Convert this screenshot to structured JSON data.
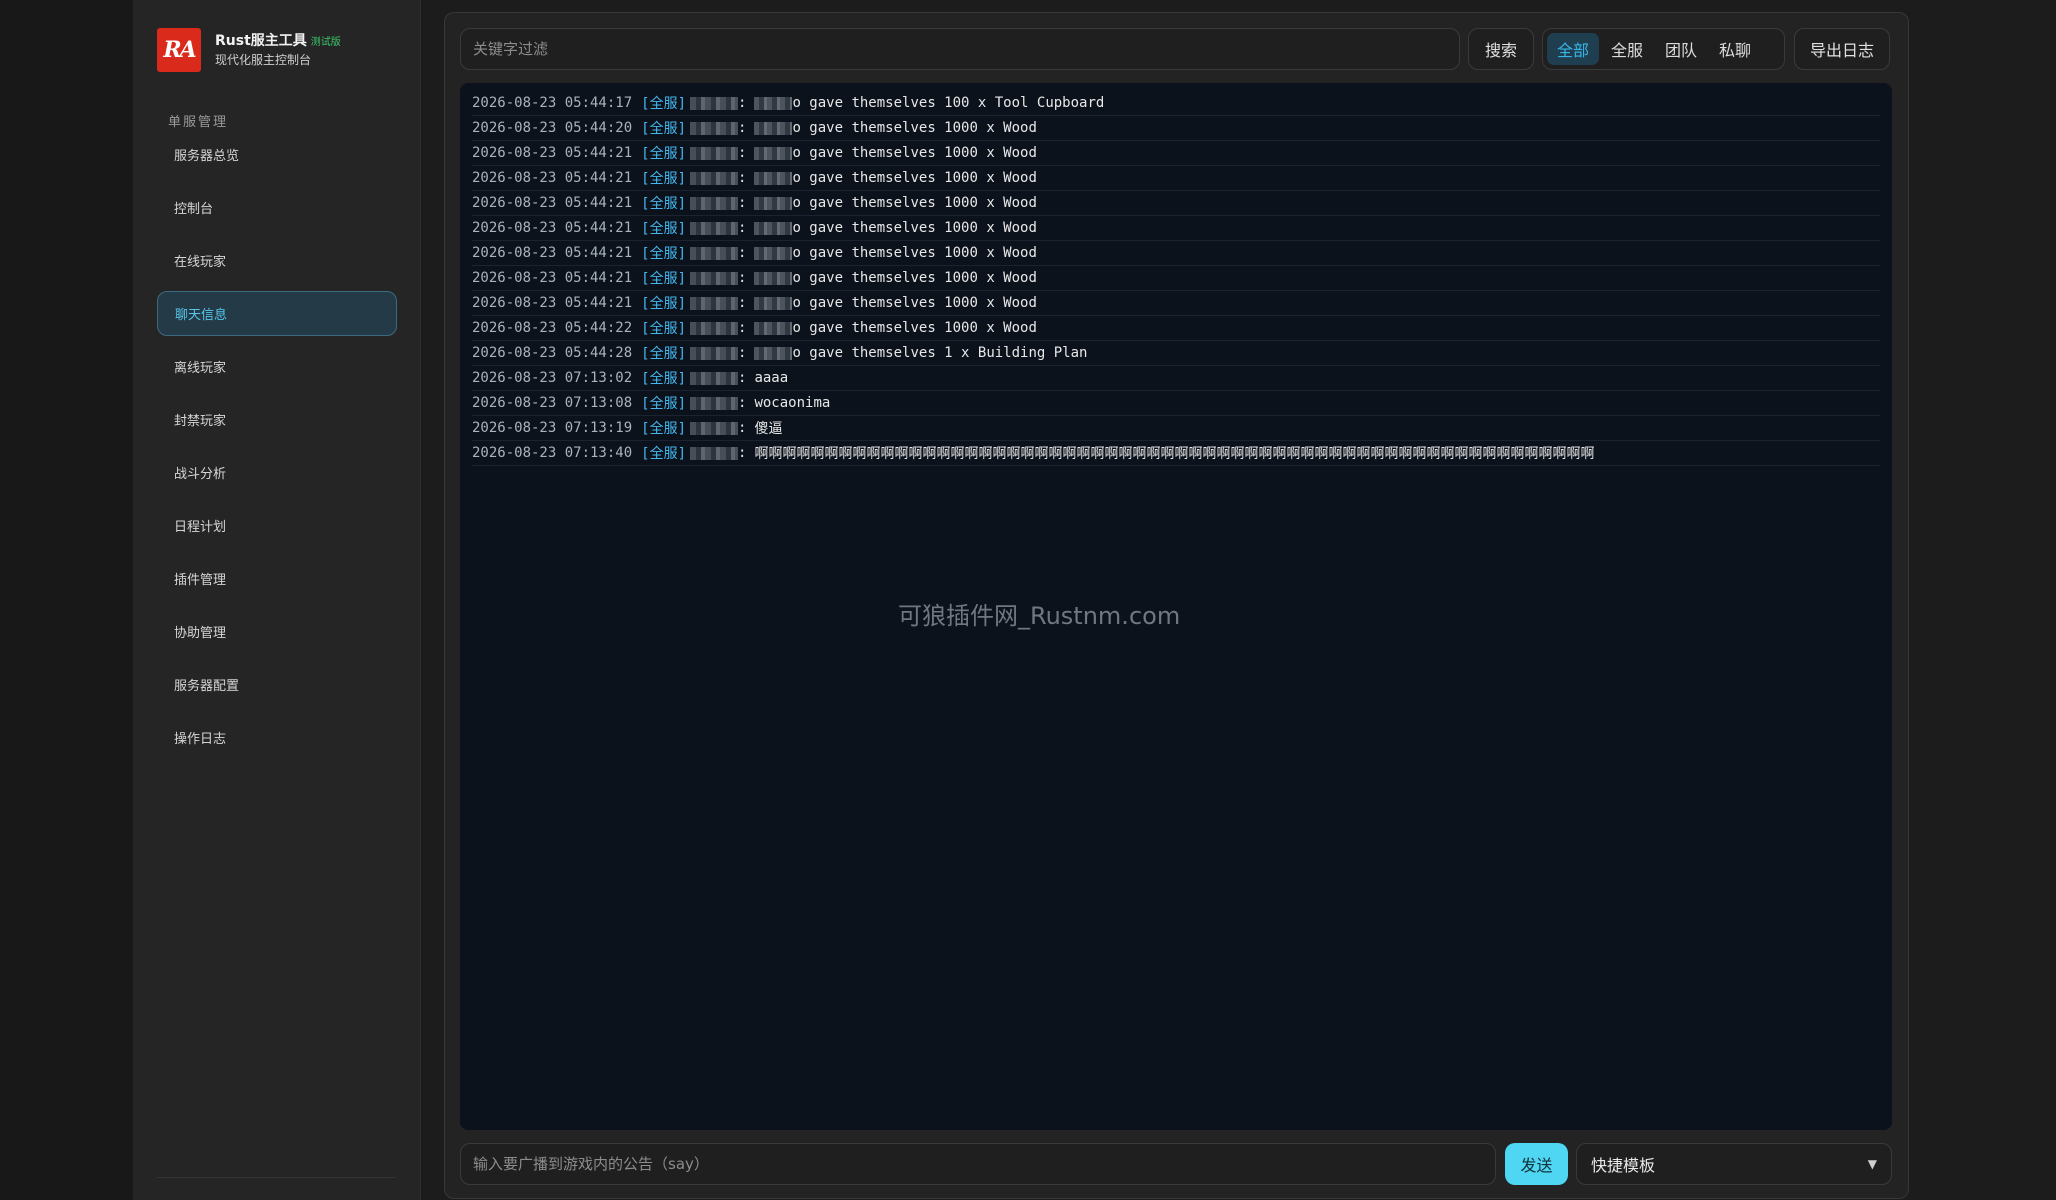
{
  "app": {
    "logo_text": "RA",
    "title": "Rust服主工具",
    "badge": "测试版",
    "subtitle": "现代化服主控制台"
  },
  "sidebar": {
    "section_label": "单服管理",
    "items": [
      {
        "label": "服务器总览",
        "active": false
      },
      {
        "label": "控制台",
        "active": false
      },
      {
        "label": "在线玩家",
        "active": false
      },
      {
        "label": "聊天信息",
        "active": true
      },
      {
        "label": "离线玩家",
        "active": false
      },
      {
        "label": "封禁玩家",
        "active": false
      },
      {
        "label": "战斗分析",
        "active": false
      },
      {
        "label": "日程计划",
        "active": false
      },
      {
        "label": "插件管理",
        "active": false
      },
      {
        "label": "协助管理",
        "active": false
      },
      {
        "label": "服务器配置",
        "active": false
      },
      {
        "label": "操作日志",
        "active": false
      }
    ]
  },
  "toolbar": {
    "filter_placeholder": "关键字过滤",
    "search_label": "搜索",
    "tabs": [
      {
        "label": "全部",
        "active": true
      },
      {
        "label": "全服",
        "active": false
      },
      {
        "label": "团队",
        "active": false
      },
      {
        "label": "私聊",
        "active": false
      }
    ],
    "export_label": "导出日志"
  },
  "log": {
    "rows": [
      {
        "ts": "2026-08-23 05:44:17",
        "channel": "[全服]",
        "tail": "o gave themselves 100 x Tool Cupboard"
      },
      {
        "ts": "2026-08-23 05:44:20",
        "channel": "[全服]",
        "tail": "o gave themselves 1000 x Wood"
      },
      {
        "ts": "2026-08-23 05:44:21",
        "channel": "[全服]",
        "tail": "o gave themselves 1000 x Wood"
      },
      {
        "ts": "2026-08-23 05:44:21",
        "channel": "[全服]",
        "tail": "o gave themselves 1000 x Wood"
      },
      {
        "ts": "2026-08-23 05:44:21",
        "channel": "[全服]",
        "tail": "o gave themselves 1000 x Wood"
      },
      {
        "ts": "2026-08-23 05:44:21",
        "channel": "[全服]",
        "tail": "o gave themselves 1000 x Wood"
      },
      {
        "ts": "2026-08-23 05:44:21",
        "channel": "[全服]",
        "tail": "o gave themselves 1000 x Wood"
      },
      {
        "ts": "2026-08-23 05:44:21",
        "channel": "[全服]",
        "tail": "o gave themselves 1000 x Wood"
      },
      {
        "ts": "2026-08-23 05:44:21",
        "channel": "[全服]",
        "tail": "o gave themselves 1000 x Wood"
      },
      {
        "ts": "2026-08-23 05:44:22",
        "channel": "[全服]",
        "tail": "o gave themselves 1000 x Wood"
      },
      {
        "ts": "2026-08-23 05:44:28",
        "channel": "[全服]",
        "tail": "o gave themselves 1 x Building Plan"
      },
      {
        "ts": "2026-08-23 07:13:02",
        "channel": "[全服]",
        "tail": "aaaa",
        "plain": true
      },
      {
        "ts": "2026-08-23 07:13:08",
        "channel": "[全服]",
        "tail": "wocaonima",
        "plain": true
      },
      {
        "ts": "2026-08-23 07:13:19",
        "channel": "[全服]",
        "tail": "傻逼",
        "plain": true
      },
      {
        "ts": "2026-08-23 07:13:40",
        "channel": "[全服]",
        "tail": "啊啊啊啊啊啊啊啊啊啊啊啊啊啊啊啊啊啊啊啊啊啊啊啊啊啊啊啊啊啊啊啊啊啊啊啊啊啊啊啊啊啊啊啊啊啊啊啊啊啊啊啊啊啊啊啊啊啊啊啊",
        "plain": true
      }
    ]
  },
  "watermark": "可狼插件网_Rustnm.com",
  "footer": {
    "say_placeholder": "输入要广播到游戏内的公告（say）",
    "send_label": "发送",
    "template_label": "快捷模板"
  },
  "colors": {
    "accent": "#4fd6f2",
    "active_nav_bg": "#243a47",
    "channel": "#44b7ee",
    "log_bg": "#0c121c"
  }
}
